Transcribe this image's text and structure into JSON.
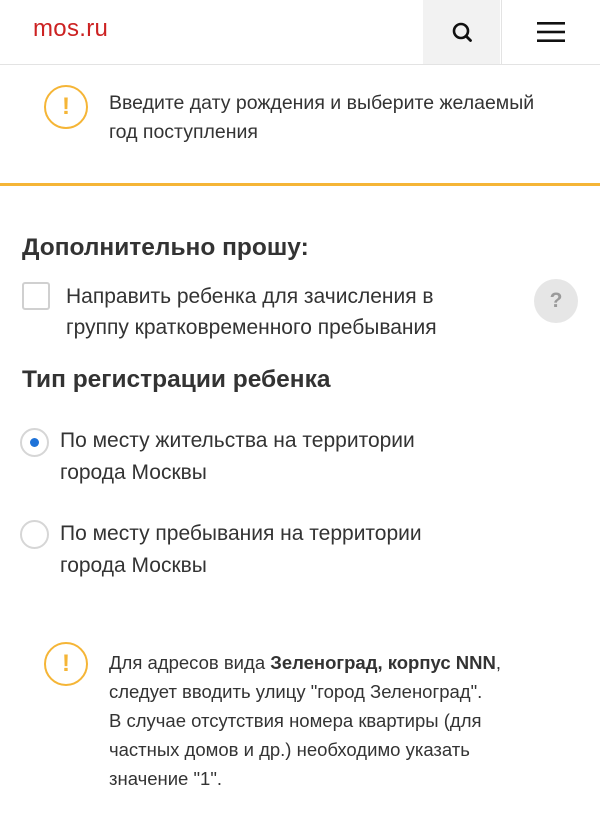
{
  "header": {
    "logo": "mos.ru",
    "search_icon": "search-icon",
    "menu_icon": "hamburger-menu-icon"
  },
  "warning_top": {
    "icon_text": "!",
    "line1": "Введите дату рождения и выберите желаемый",
    "line2": "год поступления"
  },
  "additional": {
    "title": "Дополнительно прошу:",
    "checkbox": {
      "checked": false,
      "line1": "Направить ребенка для зачисления в",
      "line2": "группу кратковременного пребывания"
    },
    "help_text": "?"
  },
  "registration": {
    "title": "Тип регистрации ребенка",
    "options": [
      {
        "line1": "По месту жительства на территории",
        "line2": "города Москвы",
        "selected": true
      },
      {
        "line1": "По месту пребывания на территории",
        "line2": "города Москвы",
        "selected": false
      }
    ]
  },
  "warning_bottom": {
    "icon_text": "!",
    "prefix": "Для адресов вида ",
    "bold": "Зеленоград, корпус NNN",
    "suffix": ",",
    "line2": "следует вводить улицу \"город Зеленоград\".",
    "line3": "В случае отсутствия номера квартиры (для",
    "line4": "частных домов и др.) необходимо указать",
    "line5": "значение \"1\"."
  },
  "colors": {
    "brand": "#cc2222",
    "warning": "#f5b536",
    "radio_selected": "#1e72d8"
  }
}
